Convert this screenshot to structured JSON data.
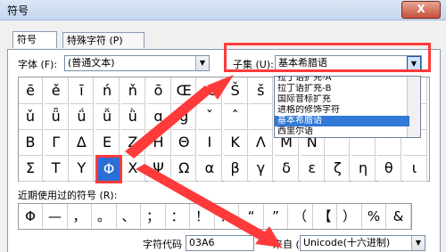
{
  "window": {
    "title": "符号",
    "close_label": "X"
  },
  "tabs": [
    {
      "label": "符号 (S)"
    },
    {
      "label": "特殊字符 (P)"
    }
  ],
  "font": {
    "label": "字体 (F):",
    "value": "(普通文本)"
  },
  "subset": {
    "label": "子集 (U):",
    "value": "基本希腊语"
  },
  "subset_options": [
    "拉丁语扩充-A",
    "拉丁语扩充-B",
    "国际音标扩充",
    "进格的修饰字符",
    "基本希腊语",
    "西里尔语"
  ],
  "grid_rows": [
    [
      "ē",
      "ě",
      "ī",
      "ń",
      "ň",
      "ō",
      "Œ",
      "œ",
      "Š",
      "š",
      "",
      "",
      "",
      "",
      "",
      ""
    ],
    [
      "ǔ",
      "ǖ",
      "ǘ",
      "ǚ",
      "ǜ",
      "ɑ",
      "g",
      "ˇ",
      "ˆ",
      "",
      "",
      "",
      "",
      "",
      "",
      ""
    ],
    [
      "Β",
      "Γ",
      "Δ",
      "Ε",
      "Ζ",
      "Η",
      "Θ",
      "Ι",
      "Κ",
      "Λ",
      "Μ",
      "Ν",
      "",
      "",
      "",
      ""
    ],
    [
      "Σ",
      "Τ",
      "Υ",
      "Φ",
      "Χ",
      "Ψ",
      "Ω",
      "α",
      "β",
      "γ",
      "δ",
      "ε",
      "ζ",
      "η",
      "θ",
      "ι"
    ]
  ],
  "selected_symbol": "Φ",
  "recent": {
    "label": "近期使用过的符号 (R):",
    "symbols": [
      "Φ",
      "—",
      "，",
      "。",
      "、",
      "；",
      "：",
      "！",
      "？",
      "“",
      "”",
      "（",
      "【",
      "）",
      "%",
      "&"
    ]
  },
  "char_code": {
    "label": "字符代码 (C):",
    "value": "03A6"
  },
  "from": {
    "label": "来自 (M):",
    "value": "Unicode(十六进制)"
  },
  "accent_color": "#ff3a3a"
}
